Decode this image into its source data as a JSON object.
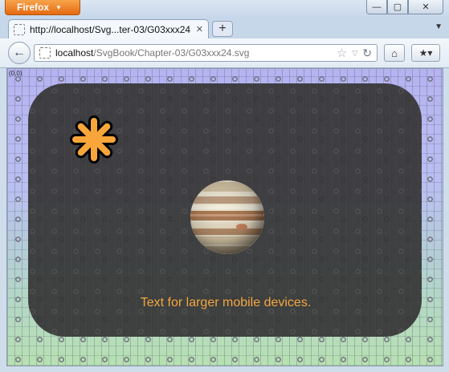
{
  "window": {
    "app_button_label": "Firefox",
    "minimize_glyph": "—",
    "maximize_glyph": "▢",
    "close_glyph": "✕"
  },
  "tabs": [
    {
      "label": "http://localhost/Svg...ter-03/G03xxx24.svg",
      "active": true
    }
  ],
  "tab_close_glyph": "✕",
  "new_tab_glyph": "+",
  "tab_list_glyph": "▼",
  "navigation": {
    "back_glyph": "←",
    "url_host": "localhost",
    "url_path": "/SvgBook/Chapter-03/G03xxx24.svg",
    "star_glyph": "☆",
    "dropdown_glyph": "▽",
    "reload_glyph": "↻",
    "home_glyph": "⌂",
    "bookmarks_glyph": "★▾"
  },
  "content": {
    "origin_label": "(0,0)",
    "caption": "Text for larger mobile devices.",
    "icons": [
      "asterisk-icon",
      "jupiter-planet-image"
    ],
    "colors": {
      "caption": "#f4a640",
      "asterisk_fill": "#f8a63a",
      "panel": "#343434",
      "background_top": "#b6b3f0",
      "background_bottom": "#b7e0b2"
    }
  }
}
